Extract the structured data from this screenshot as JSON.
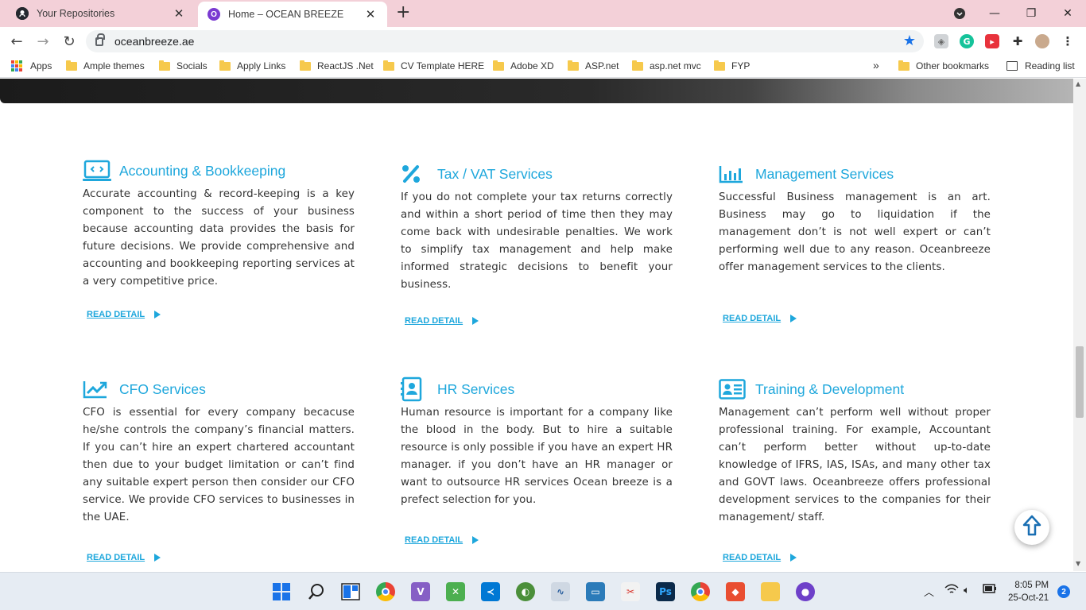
{
  "browser": {
    "tabs": [
      {
        "title": "Your Repositories",
        "icon": "github-icon"
      },
      {
        "title": "Home – OCEAN BREEZE",
        "icon": "ocean-breeze-icon"
      }
    ],
    "url": "oceanbreeze.ae",
    "bookmarks": [
      "Apps",
      "Ample themes",
      "Socials",
      "Apply Links",
      "ReactJS .Net",
      "CV Template HERE",
      "Adobe XD",
      "ASP.net",
      "asp.net mvc",
      "FYP"
    ],
    "overflow": "»",
    "other_bookmarks": "Other bookmarks",
    "reading_list": "Reading list"
  },
  "services": [
    {
      "title": "Accounting & Bookkeeping",
      "icon": "laptop-code-icon",
      "description": "Accurate accounting & record-keeping is a key component to the success of your business because accounting data provides the basis for future decisions. We provide comprehensive and accounting and bookkeeping reporting services at a very competitive price.",
      "link": "READ DETAIL"
    },
    {
      "title": "Tax / VAT Services",
      "icon": "percent-icon",
      "description": "If you do not complete your tax returns correctly and within a short period of time then they may come back with undesirable penalties. We work to simplify tax management and help make informed strategic decisions to benefit your business.",
      "link": "READ DETAIL"
    },
    {
      "title": "Management Services",
      "icon": "bar-chart-icon",
      "description": "Successful Business management is an art. Business may go to liquidation if the management don’t is not well expert or can’t performing well due to any reason. Oceanbreeze offer management services to the clients.",
      "link": "READ DETAIL"
    },
    {
      "title": "CFO Services",
      "icon": "trend-up-icon",
      "description": "CFO is essential for every company becacuse he/she controls the company’s financial matters. If you can’t hire an expert chartered accountant then due to your budget limitation or can’t find any suitable expert person then consider our CFO service. We provide CFO services to businesses in the UAE.",
      "link": "READ DETAIL"
    },
    {
      "title": "HR Services",
      "icon": "contact-book-icon",
      "description": "Human resource is important for a company like the blood in the body. But to hire a suitable resource is only possible if you have an expert HR manager. if you don’t have an HR manager or want to outsource HR services Ocean breeze is a prefect selection for you.",
      "link": "READ DETAIL"
    },
    {
      "title": "Training & Development",
      "icon": "id-card-icon",
      "description": "Management can’t perform well without proper professional training. For example, Accountant can’t perform better without up-to-date knowledge of IFRS, IAS, ISAs, and many other tax and GOVT laws. Oceanbreeze offers professional development services to the companies for their management/ staff.",
      "link": "READ DETAIL"
    }
  ],
  "taskbar": {
    "time": "8:05 PM",
    "date": "25-Oct-21",
    "notifications": "2"
  },
  "colors": {
    "accent": "#1ea7dc",
    "tab_strip": "#f3d0d8",
    "text": "#333333"
  }
}
